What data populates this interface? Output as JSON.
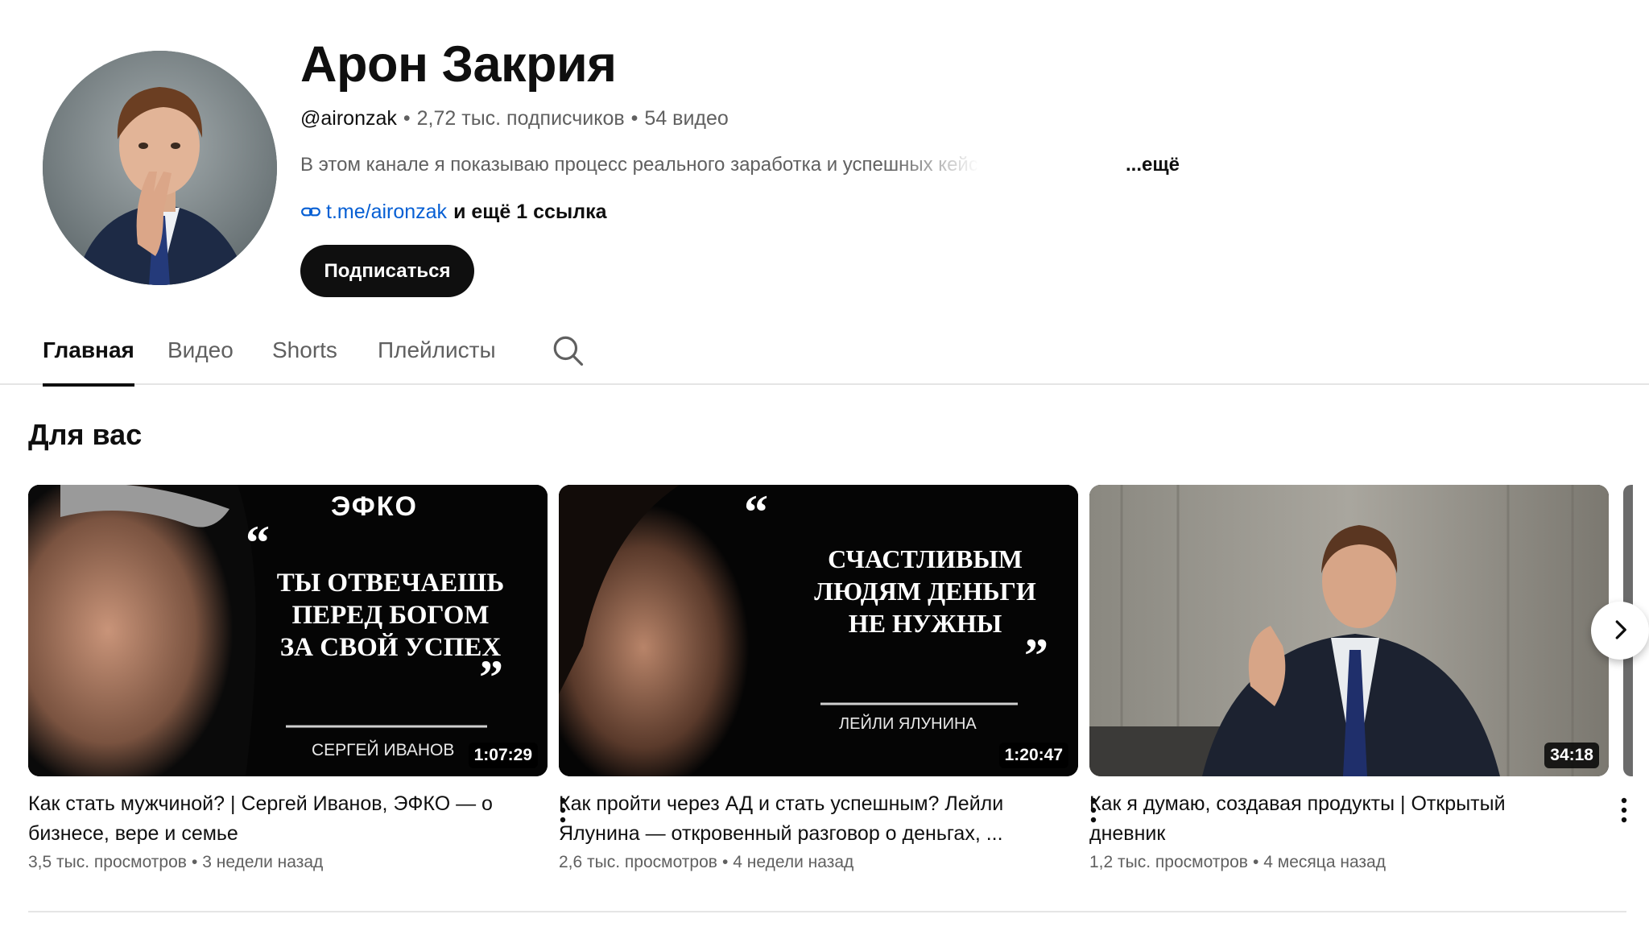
{
  "channel": {
    "name": "Арон Закрия",
    "handle": "@aironzak",
    "subscribers": "2,72 тыс. подписчиков",
    "video_count": "54 видео",
    "description": "В этом канале я показываю процесс реального заработка и успешных кейсов с",
    "description_more": "...ещё",
    "link_text": "t.me/aironzak",
    "links_more": "и ещё 1 ссылка",
    "subscribe_label": "Подписаться",
    "avatar_icon": "channel-avatar"
  },
  "tabs": [
    {
      "label": "Главная",
      "active": true
    },
    {
      "label": "Видео",
      "active": false
    },
    {
      "label": "Shorts",
      "active": false
    },
    {
      "label": "Плейлисты",
      "active": false
    }
  ],
  "tabs_search_icon": "search-icon",
  "section": {
    "title": "Для вас"
  },
  "videos": [
    {
      "title": "Как стать мужчиной? | Сергей Иванов, ЭФКО — о бизнесе, вере и семье",
      "views": "3,5 тыс. просмотров",
      "age": "3 недели назад",
      "duration": "1:07:29",
      "thumb": {
        "brand": "ЭФКО",
        "quote_lines": [
          "ТЫ ОТВЕЧАЕШЬ",
          "ПЕРЕД БОГОМ",
          "ЗА СВОЙ УСПЕХ"
        ],
        "speaker": "СЕРГЕЙ ИВАНОВ"
      }
    },
    {
      "title": "Как пройти через АД и стать успешным? Лейли Ялунина — откровенный разговор о деньгах, ...",
      "views": "2,6 тыс. просмотров",
      "age": "4 недели назад",
      "duration": "1:20:47",
      "thumb": {
        "quote_lines": [
          "СЧАСТЛИВЫМ",
          "ЛЮДЯМ ДЕНЬГИ",
          "НЕ НУЖНЫ"
        ],
        "speaker": "ЛЕЙЛИ ЯЛУНИНА"
      }
    },
    {
      "title": "Как я думаю, создавая продукты | Открытый дневник",
      "views": "1,2 тыс. просмотров",
      "age": "4 месяца назад",
      "duration": "34:18"
    }
  ],
  "colors": {
    "link": "#065fd4",
    "text_primary": "#0f0f0f",
    "text_secondary": "#606060",
    "button_bg": "#0f0f0f"
  },
  "icons": {
    "link": "link-icon",
    "kebab": "more-vert-icon",
    "next": "chevron-right-icon"
  }
}
